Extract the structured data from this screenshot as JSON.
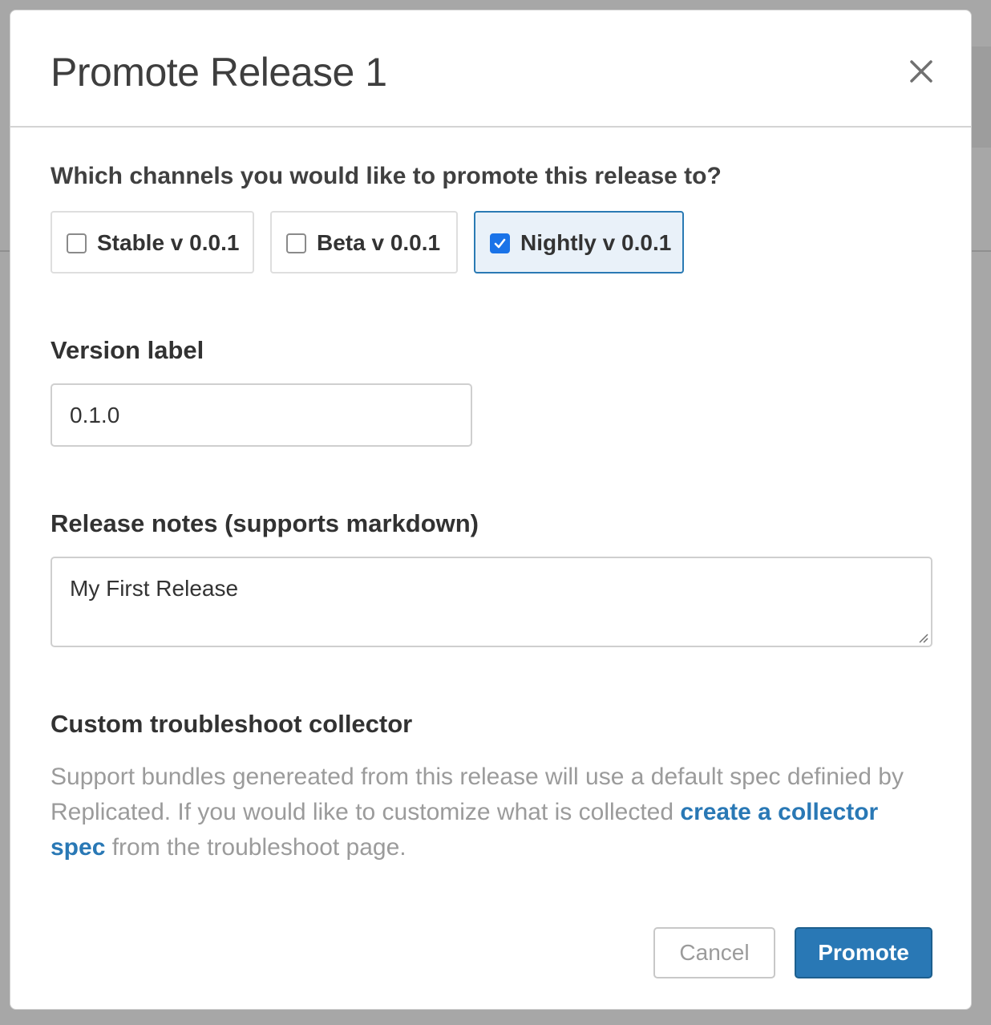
{
  "modal": {
    "title": "Promote Release 1"
  },
  "channels": {
    "question": "Which channels you would like to promote this release to?",
    "items": [
      {
        "label": "Stable v 0.0.1",
        "checked": false
      },
      {
        "label": "Beta v 0.0.1",
        "checked": false
      },
      {
        "label": "Nightly v 0.0.1",
        "checked": true
      }
    ]
  },
  "version": {
    "label": "Version label",
    "value": "0.1.0"
  },
  "notes": {
    "label": "Release notes (supports markdown)",
    "value": "My First Release"
  },
  "collector": {
    "heading": "Custom troubleshoot collector",
    "text_before": "Support bundles genereated from this release will use a default spec definied by Replicated. If you would like to customize what is collected ",
    "link_text": "create a collector spec",
    "text_after": " from the troubleshoot page."
  },
  "actions": {
    "cancel_label": "Cancel",
    "promote_label": "Promote"
  },
  "colors": {
    "accent": "#2978b5",
    "checkbox": "#1a73e8",
    "selected_bg": "#e9f1f9"
  }
}
